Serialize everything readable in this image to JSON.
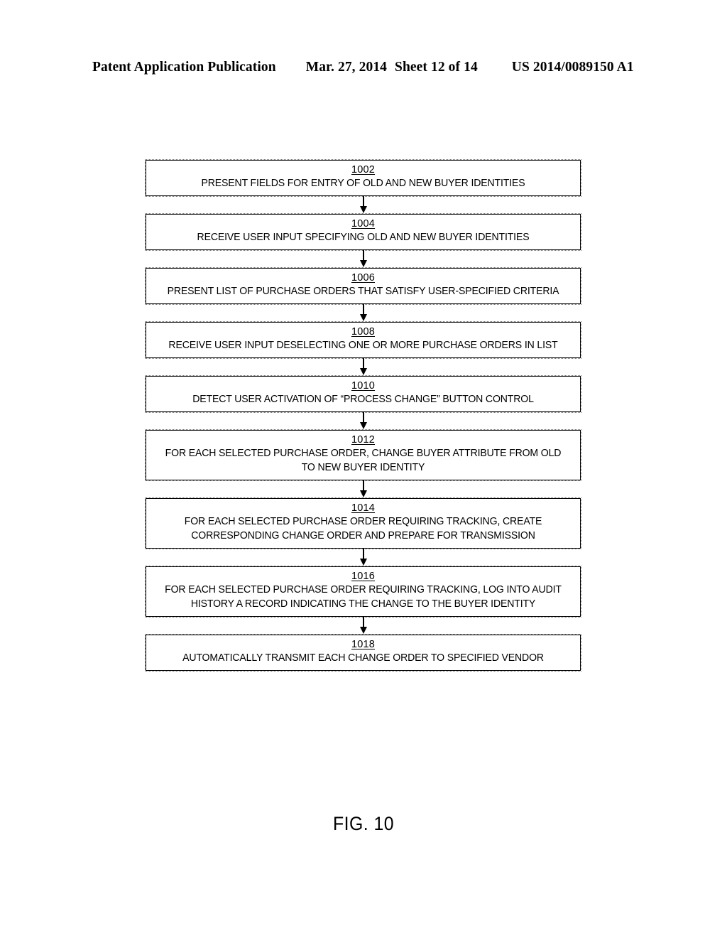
{
  "header": {
    "publication": "Patent Application Publication",
    "date": "Mar. 27, 2014",
    "sheet": "Sheet 12 of 14",
    "patent_number": "US 2014/0089150 A1"
  },
  "figure": {
    "caption": "FIG. 10"
  },
  "flowchart": {
    "steps": [
      {
        "ref": "1002",
        "text": "PRESENT FIELDS FOR ENTRY OF OLD AND NEW BUYER IDENTITIES"
      },
      {
        "ref": "1004",
        "text": "RECEIVE USER INPUT SPECIFYING OLD AND NEW BUYER IDENTITIES"
      },
      {
        "ref": "1006",
        "text": "PRESENT LIST OF PURCHASE ORDERS THAT SATISFY USER-SPECIFIED CRITERIA"
      },
      {
        "ref": "1008",
        "text": "RECEIVE USER INPUT DESELECTING ONE OR MORE PURCHASE ORDERS IN LIST"
      },
      {
        "ref": "1010",
        "text": "DETECT USER ACTIVATION OF “PROCESS CHANGE” BUTTON CONTROL"
      },
      {
        "ref": "1012",
        "text": "FOR EACH SELECTED PURCHASE ORDER, CHANGE BUYER ATTRIBUTE FROM OLD\nTO NEW BUYER IDENTITY"
      },
      {
        "ref": "1014",
        "text": "FOR EACH SELECTED PURCHASE ORDER REQUIRING TRACKING, CREATE\nCORRESPONDING CHANGE ORDER AND PREPARE FOR TRANSMISSION"
      },
      {
        "ref": "1016",
        "text": "FOR EACH SELECTED PURCHASE ORDER REQUIRING TRACKING, LOG INTO AUDIT\nHISTORY A RECORD INDICATING THE CHANGE TO THE BUYER IDENTITY"
      },
      {
        "ref": "1018",
        "text": "AUTOMATICALLY TRANSMIT EACH CHANGE ORDER TO SPECIFIED VENDOR"
      }
    ]
  }
}
